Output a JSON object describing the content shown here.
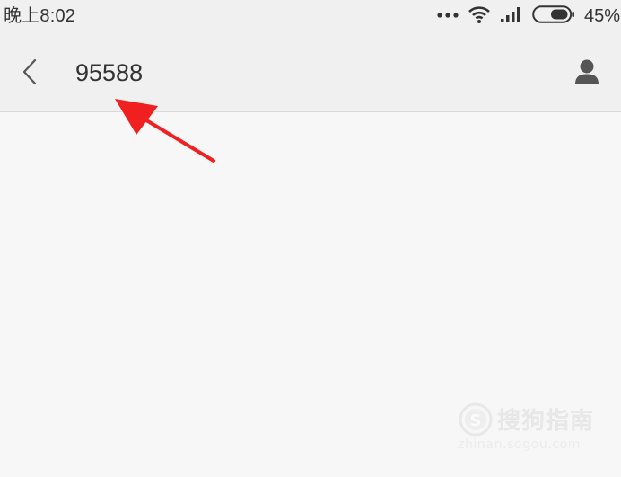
{
  "status_bar": {
    "time": "晚上8:02",
    "battery_percent": "45%",
    "icons": [
      "more-dots-icon",
      "wifi-icon",
      "signal-icon",
      "battery-icon"
    ]
  },
  "header": {
    "title": "95588",
    "back_icon": "chevron-left-icon",
    "contact_icon": "person-icon"
  },
  "annotation": {
    "color": "#f02020"
  },
  "watermark": {
    "brand": "搜狗指南",
    "url": "zhinan.sogou.com"
  }
}
